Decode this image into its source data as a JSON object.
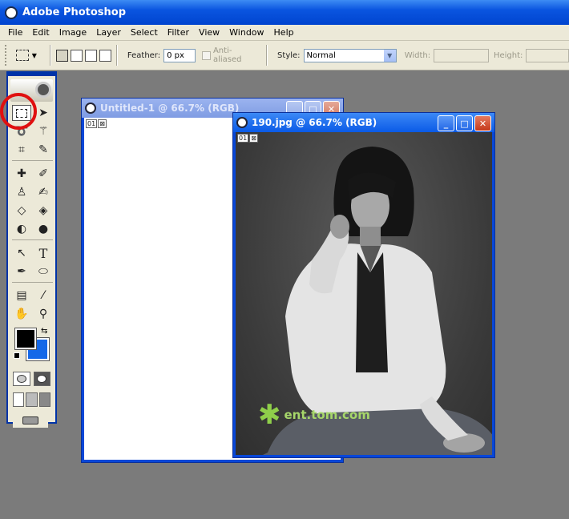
{
  "app": {
    "title": "Adobe Photoshop"
  },
  "menu": [
    "File",
    "Edit",
    "Image",
    "Layer",
    "Select",
    "Filter",
    "View",
    "Window",
    "Help"
  ],
  "options": {
    "feather_label": "Feather:",
    "feather_value": "0 px",
    "anti_aliased_label": "Anti-aliased",
    "style_label": "Style:",
    "style_value": "Normal",
    "width_label": "Width:",
    "height_label": "Height:"
  },
  "windows": {
    "untitled": {
      "title": "Untitled-1 @ 66.7% (RGB)",
      "badge": "01"
    },
    "photo": {
      "title": "190.jpg @ 66.7% (RGB)",
      "badge": "01"
    }
  },
  "watermark": {
    "text": "ent.tom.com"
  },
  "colors": {
    "foreground": "#000000",
    "background": "#1468e8",
    "highlight": "#e01010"
  }
}
